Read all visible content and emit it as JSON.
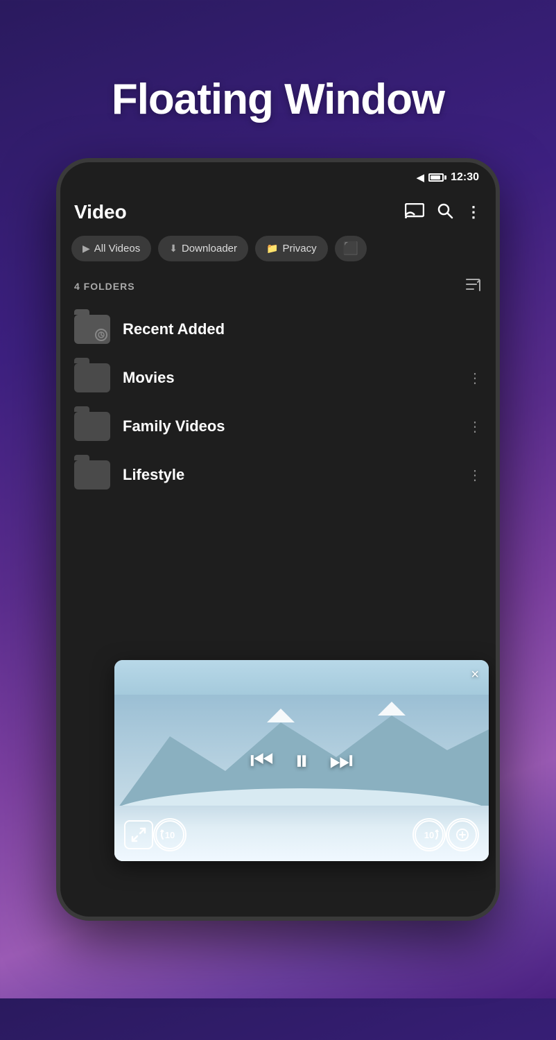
{
  "page": {
    "heading": "Floating Window"
  },
  "status_bar": {
    "time": "12:30"
  },
  "header": {
    "title": "Video",
    "cast_label": "cast",
    "search_label": "search",
    "more_label": "more options"
  },
  "tabs": [
    {
      "id": "all-videos",
      "icon": "▶",
      "label": "All Videos"
    },
    {
      "id": "downloader",
      "icon": "⬇",
      "label": "Downloader"
    },
    {
      "id": "privacy",
      "icon": "📁",
      "label": "Privacy"
    },
    {
      "id": "more",
      "icon": "⬛",
      "label": ""
    }
  ],
  "folders_section": {
    "count_label": "4 FOLDERS"
  },
  "folders": [
    {
      "id": "recent-added",
      "name": "Recent Added",
      "has_more": false,
      "is_recent": true
    },
    {
      "id": "movies",
      "name": "Movies",
      "has_more": true,
      "is_recent": false
    },
    {
      "id": "family-videos",
      "name": "Family Videos",
      "has_more": true,
      "is_recent": false
    },
    {
      "id": "lifestyle",
      "name": "Lifestyle",
      "has_more": true,
      "is_recent": false
    }
  ],
  "floating_player": {
    "close_label": "×",
    "prev_label": "⏮",
    "pause_label": "⏸",
    "next_label": "⏭",
    "expand_label": "⤢",
    "rewind_label": "10",
    "forward_label": "10",
    "zoom_label": "+"
  }
}
